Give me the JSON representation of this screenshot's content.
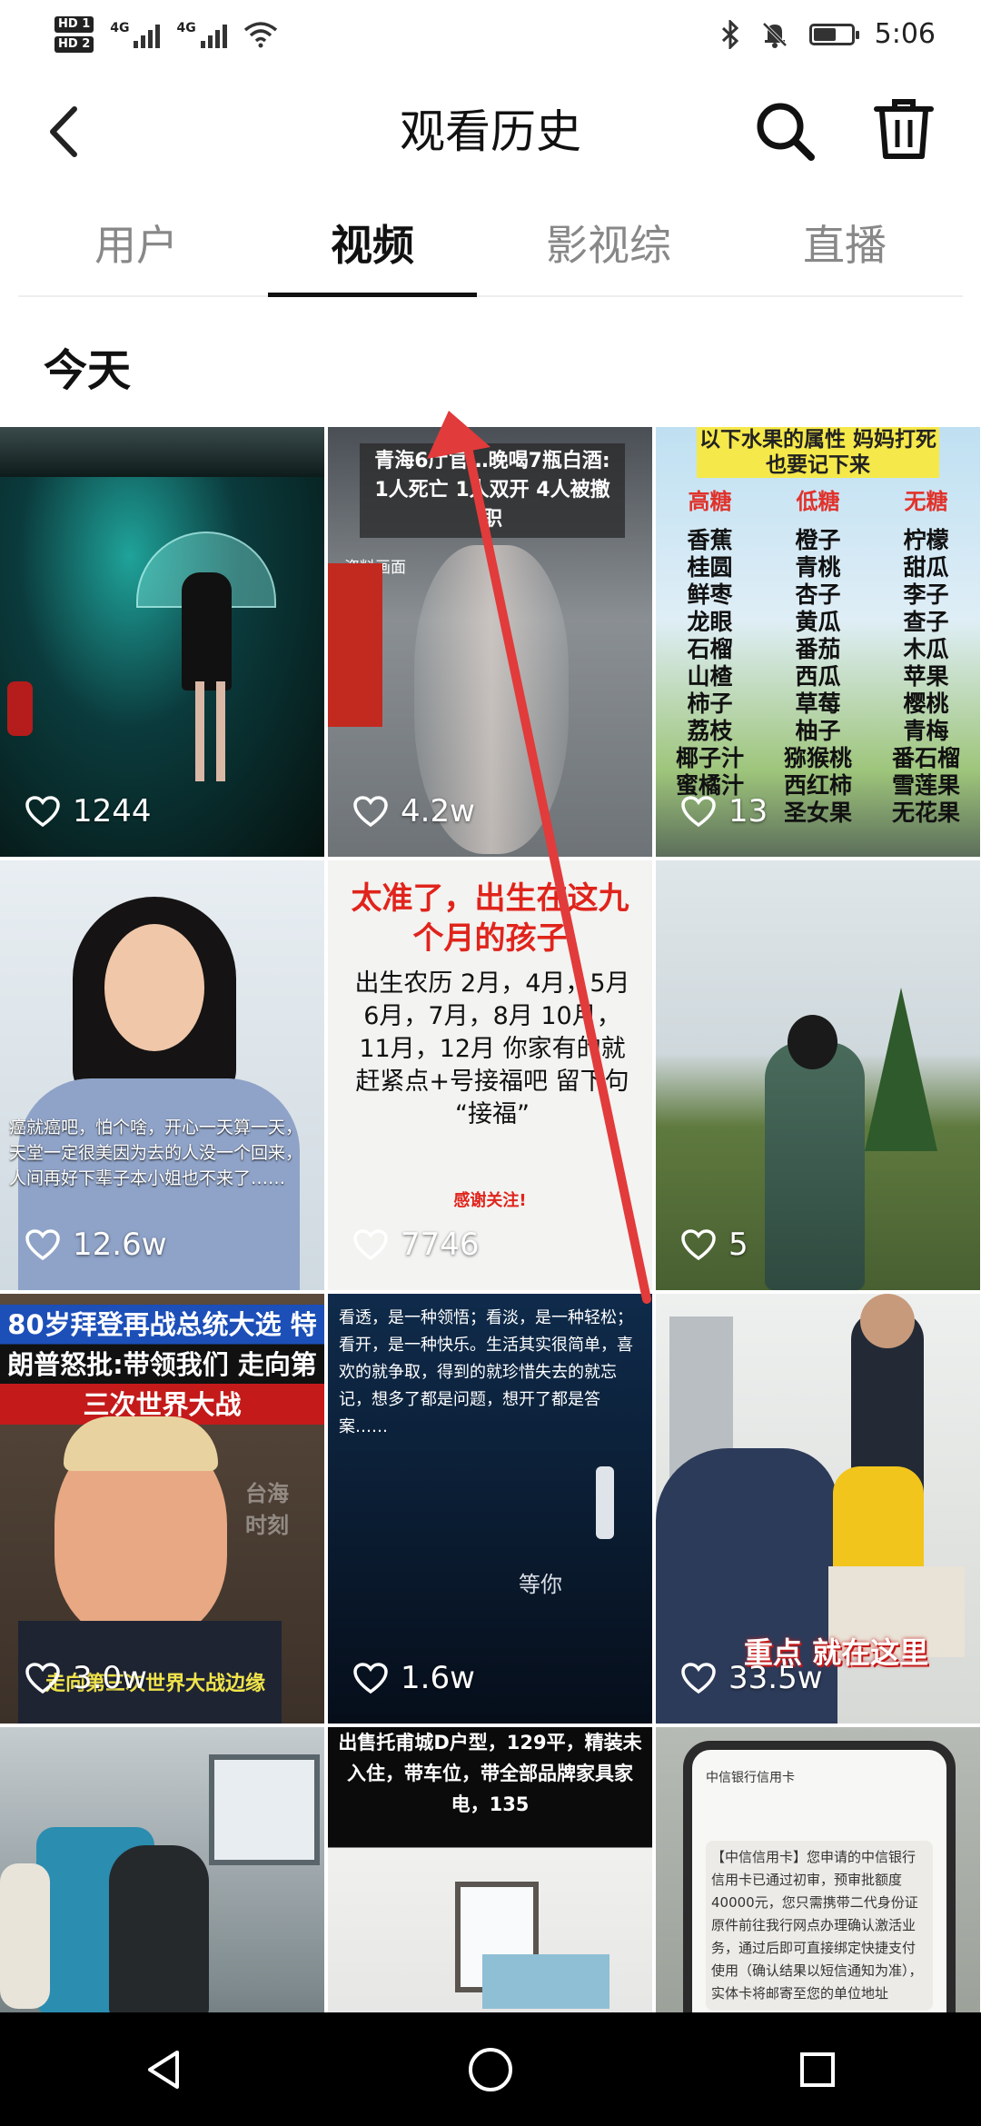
{
  "status_bar": {
    "hd1": "HD 1",
    "hd2": "HD 2",
    "net1": "4G",
    "net2": "4G",
    "time": "5:06",
    "battery_level": 0.6
  },
  "header": {
    "title": "观看历史",
    "back_icon": "chevron-left-icon",
    "search_icon": "search-icon",
    "trash_icon": "trash-icon"
  },
  "tabs": [
    {
      "label": "用户",
      "active": false
    },
    {
      "label": "视频",
      "active": true
    },
    {
      "label": "影视综",
      "active": false
    },
    {
      "label": "直播",
      "active": false
    }
  ],
  "section": {
    "title": "今天"
  },
  "videos": [
    {
      "likes": "1244",
      "caption": ""
    },
    {
      "likes": "4.2w",
      "caption": "青海6厅官…晚喝7瓶白酒: 1人死亡 1人双开 4人被撤职",
      "sub": "资料画面"
    },
    {
      "likes": "13",
      "caption": "以下水果的属性 妈妈打死也要记下来",
      "cols": [
        "高糖",
        "低糖",
        "无糖"
      ],
      "fruits": [
        [
          "香蕉",
          "桂圆",
          "鲜枣",
          "龙眼",
          "石榴",
          "山楂",
          "柿子",
          "荔枝",
          "椰子汁",
          "蜜橘汁"
        ],
        [
          "橙子",
          "青桃",
          "杏子",
          "黄瓜",
          "番茄",
          "西瓜",
          "草莓",
          "柚子",
          "猕猴桃",
          "西红柿",
          "圣女果"
        ],
        [
          "柠檬",
          "甜瓜",
          "李子",
          "查子",
          "木瓜",
          "苹果",
          "樱桃",
          "青梅",
          "番石榴",
          "雪莲果",
          "无花果"
        ]
      ]
    },
    {
      "likes": "12.6w",
      "caption": "癌就癌吧，怕个啥，开心一天算一天，天堂一定很美因为去的人没一个回来，人间再好下辈子本小姐也不来了……"
    },
    {
      "likes": "7746",
      "caption": "太准了，出生在这九个月的孩子",
      "body": "出生农历 2月，4月，5月 6月，7月，8月 10月，11月，12月 你家有的就赶紧点+号接福吧 留下句 “接福”",
      "footer": "感谢关注!"
    },
    {
      "likes": "5",
      "caption": ""
    },
    {
      "likes": "3.0w",
      "caption": "80岁拜登再战总统大选 特朗普怒批:带领我们 走向第三次世界大战",
      "footer": "走向第三次世界大战边缘",
      "watermark": "台海时刻"
    },
    {
      "likes": "1.6w",
      "caption": "看透，是一种领悟；看淡，是一种轻松；看开，是一种快乐。生活其实很简单，喜欢的就争取，得到的就珍惜失去的就忘记，想多了都是问题，想开了都是答案……",
      "sub": "等你"
    },
    {
      "likes": "33.5w",
      "caption": "重点 就在这里"
    },
    {
      "likes": "",
      "caption": ""
    },
    {
      "likes": "",
      "caption": "出售托甫城D户型，129平，精装未入住，带车位，带全部品牌家具家电，135"
    },
    {
      "likes": "",
      "caption": "【中信信用卡】您申请的中信银行信用卡已通过初审，预审批额度40000元，您只需携带二代身份证原件前往我行网点办理确认激活业务，通过后即可直接绑定快捷支付使用（确认结果以短信通知为准），实体卡将邮寄至您的单位地址",
      "sub": "中信银行信用卡"
    }
  ],
  "nav": {
    "back_icon": "triangle-back-icon",
    "home_icon": "circle-home-icon",
    "recents_icon": "square-recents-icon"
  }
}
